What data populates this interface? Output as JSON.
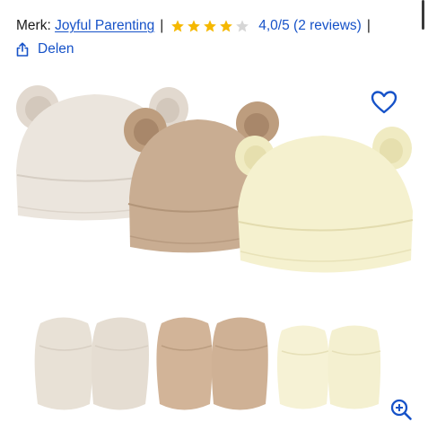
{
  "product": {
    "brand_prefix": "Merk:",
    "brand_name": "Joyful Parenting",
    "separator": "|",
    "rating": {
      "value": 4,
      "max": 5,
      "label": "4,0/5 (2 reviews)"
    },
    "share_label": "Delen"
  },
  "icons": {
    "share": "share-icon",
    "favorite": "heart-icon",
    "zoom": "zoom-in-icon",
    "star_filled": "star-filled-icon",
    "star_empty": "star-empty-icon"
  },
  "colors": {
    "link": "#1652c8",
    "star_filled": "#f5b800",
    "star_empty": "#d6d6d6",
    "hat_beige": "#e9e2d9",
    "hat_brown": "#c6a98c",
    "hat_yellow": "#f3efc9"
  }
}
